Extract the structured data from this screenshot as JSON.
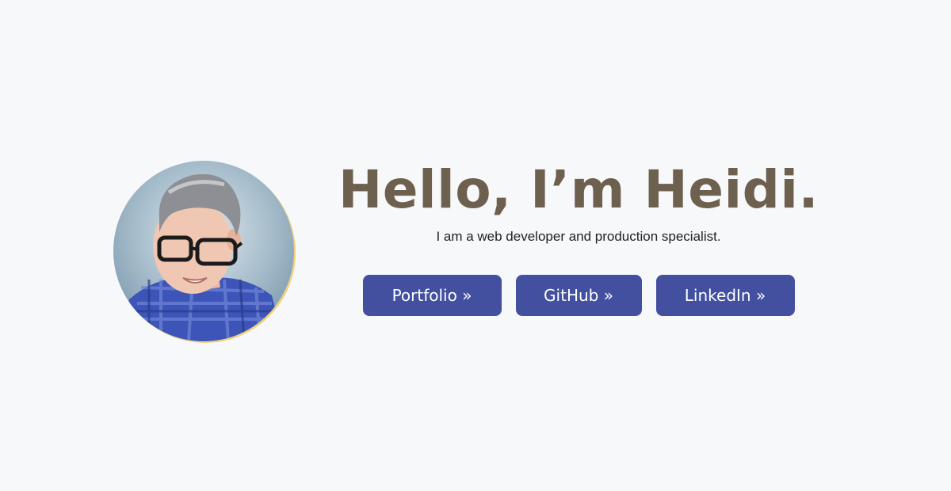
{
  "profile": {
    "avatar_icon": "profile-photo",
    "ring_color": "#f2d17a"
  },
  "hero": {
    "title": "Hello, I’m Heidi.",
    "subtitle": "I am a web developer and production specialist."
  },
  "buttons": [
    {
      "label": "Portfolio »"
    },
    {
      "label": "GitHub »"
    },
    {
      "label": "LinkedIn »"
    }
  ],
  "colors": {
    "background": "#f7f8fa",
    "title": "#6e604f",
    "button": "#4350a0",
    "button_text": "#ffffff"
  }
}
